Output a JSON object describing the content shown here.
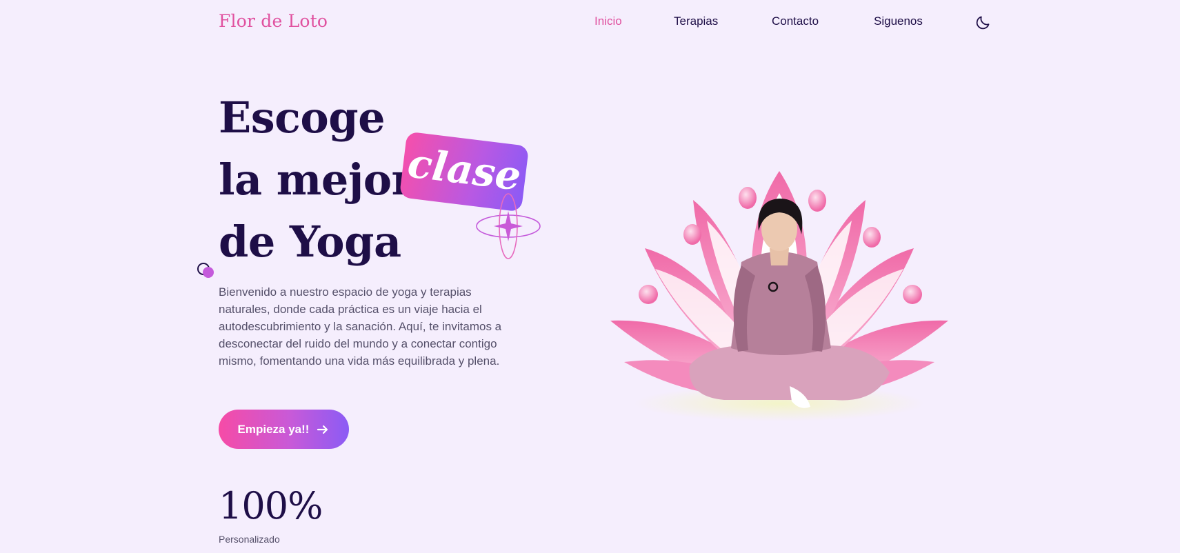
{
  "brand": {
    "logo_text": "Flor de Loto"
  },
  "nav": {
    "items": [
      {
        "label": "Inicio",
        "active": true
      },
      {
        "label": "Terapias",
        "active": false
      },
      {
        "label": "Contacto",
        "active": false
      },
      {
        "label": "Siguenos",
        "active": false
      }
    ],
    "theme_toggle_icon": "moon-icon"
  },
  "hero": {
    "title_lines": [
      "Escoge",
      "la mejor",
      "de Yoga"
    ],
    "highlight_word": "clase",
    "description": "Bienvenido a nuestro espacio de yoga y terapias naturales, donde cada práctica es un viaje hacia el autodescubrimiento y la sanación. Aquí, te invitamos a desconectar del ruido del mundo y a conectar contigo mismo, fomentando una vida más equilibrada y plena.",
    "cta_label": "Empieza ya!!",
    "cta_icon": "arrow-right-icon"
  },
  "stats": [
    {
      "value": "100%",
      "label": "Personalizado"
    }
  ],
  "colors": {
    "accent_pink": "#e0519f",
    "gradient_start": "#f64ba6",
    "gradient_end": "#8b5bf5",
    "heading": "#1e0e47",
    "background": "#f5eefd"
  }
}
